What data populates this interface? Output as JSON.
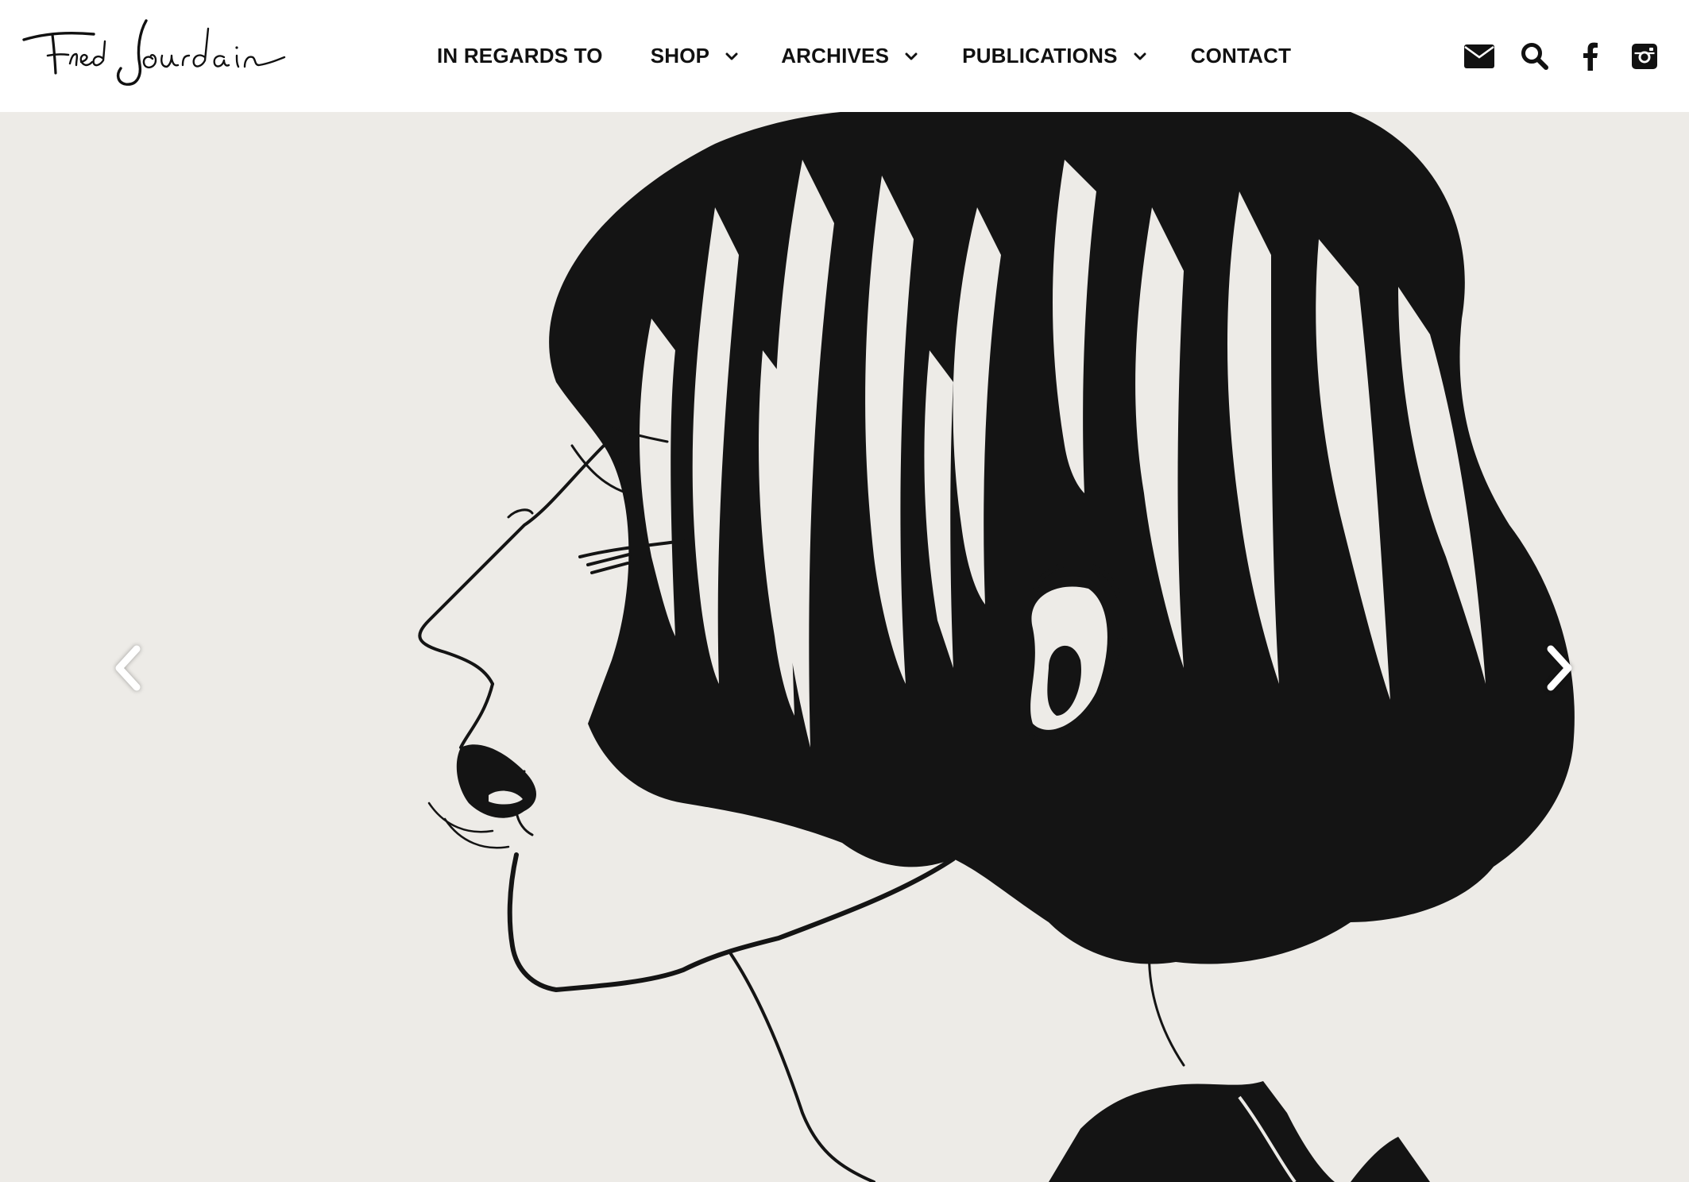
{
  "site": {
    "logo_text": "Fred Jourdain"
  },
  "nav": {
    "items": [
      {
        "label": "IN REGARDS TO",
        "has_dropdown": false
      },
      {
        "label": "SHOP",
        "has_dropdown": true
      },
      {
        "label": "ARCHIVES",
        "has_dropdown": true
      },
      {
        "label": "PUBLICATIONS",
        "has_dropdown": true
      },
      {
        "label": "CONTACT",
        "has_dropdown": false
      }
    ]
  },
  "social": {
    "icons": [
      "envelope-icon",
      "search-icon",
      "facebook-icon",
      "instagram-icon"
    ]
  },
  "hero": {
    "icons": [
      "chevron-left-icon",
      "chevron-right-icon"
    ],
    "artwork_subject": "ink drawing, woman's profile with bob haircut"
  },
  "colors": {
    "header_bg": "#ffffff",
    "nav_text": "#111111",
    "hero_bg": "#edebe7",
    "ink": "#141414",
    "arrow": "#ffffff"
  }
}
